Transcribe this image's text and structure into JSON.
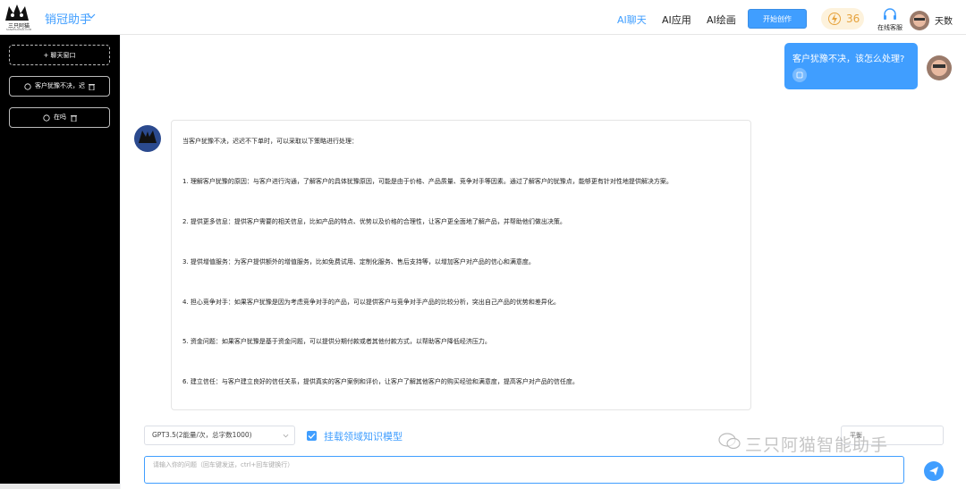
{
  "header": {
    "logo_text": "三只阿猫",
    "logo_sub": "SANZHIAMAO.COM",
    "app_title": "销冠助手",
    "nav": [
      "AI聊天",
      "AI应用",
      "AI绘画"
    ],
    "start_button": "开始创作",
    "points": "36",
    "service_label": "在线客服",
    "user_name": "天数"
  },
  "sidebar": {
    "new_chat_label": "+ 聊天窗口",
    "history": [
      "客户犹豫不决，迟",
      "在吗"
    ]
  },
  "chat": {
    "user_message": "客户犹豫不决，该怎么处理?",
    "bot_avatar_text": "销冠助手",
    "bot_lines": [
      "当客户犹豫不决，迟迟不下单时，可以采取以下策略进行处理：",
      "1. 理解客户犹豫的原因：与客户进行沟通，了解客户的具体犹豫原因，可能是由于价格、产品质量、竞争对手等因素。通过了解客户的犹豫点，能够更有针对性地提供解决方案。",
      "2. 提供更多信息：提供客户需要的相关信息，比如产品的特点、优势以及价格的合理性，让客户更全面地了解产品，并帮助他们做出决策。",
      "3. 提供增值服务：为客户提供额外的增值服务，比如免费试用、定制化服务、售后支持等，以增加客户对产品的信心和满意度。",
      "4. 担心竞争对手：如果客户犹豫是因为考虑竞争对手的产品，可以提供客户与竞争对手产品的比较分析，突出自己产品的优势和差异化。",
      "5. 资金问题：如果客户犹豫是基于资金问题，可以提供分期付款或者其他付款方式，以帮助客户降低经济压力。",
      "6. 建立信任：与客户建立良好的信任关系，提供真实的客户案例和评价，让客户了解其他客户的购买经验和满意度，提高客户对产品的信任度。"
    ]
  },
  "composer": {
    "model": "GPT3.5(2能量/次，总字数1000)",
    "knowledge_label": "挂载领域知识模型",
    "mode": "平衡",
    "placeholder": "请输入你的问题（回车键发送，ctrl+回车键换行）",
    "watermark": "三只阿猫智能助手"
  },
  "colors": {
    "accent": "#409eff",
    "sidebar": "#000000",
    "points_bg": "#fdf2dc"
  }
}
